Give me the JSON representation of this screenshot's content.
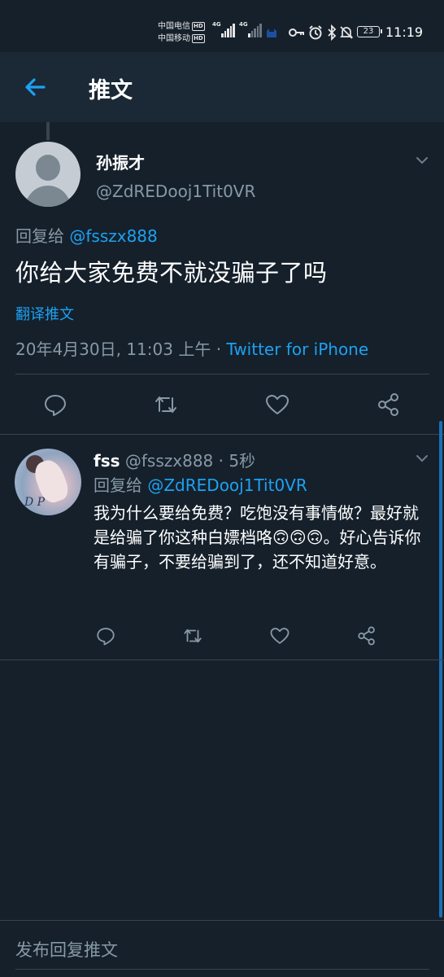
{
  "status_bar": {
    "carrier1": "中国电信",
    "carrier2": "中国移动",
    "hd_label": "HD",
    "net1": "4G",
    "net2": "4G",
    "battery": "23",
    "time": "11:19"
  },
  "app_bar": {
    "title": "推文"
  },
  "main_tweet": {
    "name": "孙振才",
    "handle": "@ZdREDooj1Tit0VR",
    "reply_prefix": "回复给",
    "reply_to": "@fsszx888",
    "text": "你给大家免费不就没骗子了吗",
    "translate": "翻译推文",
    "timestamp": "20年4月30日, 11:03 上午 · ",
    "source": "Twitter for iPhone"
  },
  "reply_tweet": {
    "name": "fss",
    "handle": "@fsszx888",
    "time_sep": " · ",
    "time": "5秒",
    "reply_prefix": "回复给",
    "reply_to": "@ZdREDooj1Tit0VR",
    "text": "我为什么要给免费？吃饱没有事情做？最好就是给骗了你这种白嫖档咯🙃🙃🙃。好心告诉你有骗子，不要给骗到了，还不知道好意。",
    "avatar_text": "D P"
  },
  "composer": {
    "placeholder": "发布回复推文"
  },
  "colors": {
    "background": "#15202b",
    "appbar": "#1b2836",
    "accent": "#1da1f2",
    "secondary_text": "#8899a6",
    "divider": "#38444d"
  },
  "icons": [
    "back-arrow-icon",
    "chevron-down-icon",
    "reply-icon",
    "retweet-icon",
    "like-icon",
    "share-icon",
    "key-icon",
    "alarm-icon",
    "bluetooth-icon",
    "mute-bell-icon"
  ]
}
